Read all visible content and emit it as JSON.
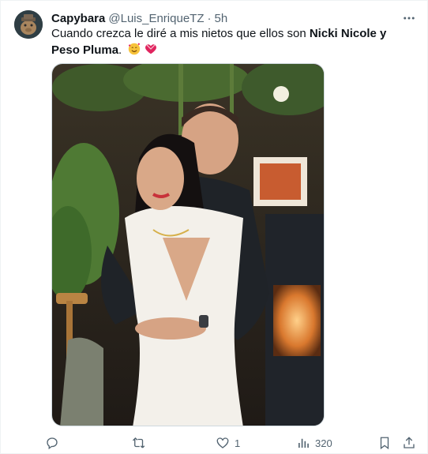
{
  "tweet": {
    "author": {
      "display_name": "Capybara",
      "handle": "@Luis_EnriqueTZ",
      "avatar_icon": "capybara-avatar"
    },
    "separator": "·",
    "time": "5h",
    "text_parts": {
      "part1": "Cuando crezca le diré a mis nietos que ellos son ",
      "bold1": "Nicki Nicole y Peso Pluma",
      "part2": "."
    },
    "emojis": [
      "smiling-face-with-hearts-emoji",
      "heart-with-ribbon-emoji"
    ],
    "media": {
      "description_icon": "photo"
    },
    "actions": {
      "reply_count": "",
      "retweet_count": "",
      "like_count": "1",
      "views_count": "320"
    }
  },
  "colors": {
    "text_primary": "#0f1419",
    "text_secondary": "#536471",
    "border": "#cfd9de"
  }
}
